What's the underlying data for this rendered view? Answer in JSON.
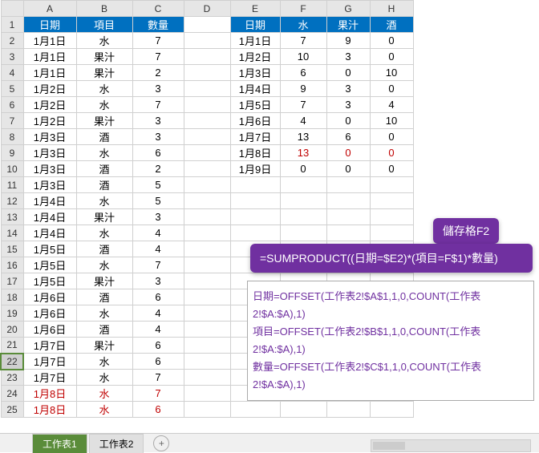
{
  "cols": [
    "A",
    "B",
    "C",
    "D",
    "E",
    "F",
    "G",
    "H"
  ],
  "left_headers": [
    "日期",
    "項目",
    "數量"
  ],
  "left_rows": [
    [
      "1月1日",
      "水",
      "7"
    ],
    [
      "1月1日",
      "果汁",
      "7"
    ],
    [
      "1月1日",
      "果汁",
      "2"
    ],
    [
      "1月2日",
      "水",
      "3"
    ],
    [
      "1月2日",
      "水",
      "7"
    ],
    [
      "1月2日",
      "果汁",
      "3"
    ],
    [
      "1月3日",
      "酒",
      "3"
    ],
    [
      "1月3日",
      "水",
      "6"
    ],
    [
      "1月3日",
      "酒",
      "2"
    ],
    [
      "1月3日",
      "酒",
      "5"
    ],
    [
      "1月4日",
      "水",
      "5"
    ],
    [
      "1月4日",
      "果汁",
      "3"
    ],
    [
      "1月4日",
      "水",
      "4"
    ],
    [
      "1月5日",
      "酒",
      "4"
    ],
    [
      "1月5日",
      "水",
      "7"
    ],
    [
      "1月5日",
      "果汁",
      "3"
    ],
    [
      "1月6日",
      "酒",
      "6"
    ],
    [
      "1月6日",
      "水",
      "4"
    ],
    [
      "1月6日",
      "酒",
      "4"
    ],
    [
      "1月7日",
      "果汁",
      "6"
    ],
    [
      "1月7日",
      "水",
      "6"
    ],
    [
      "1月7日",
      "水",
      "7"
    ],
    [
      "1月8日",
      "水",
      "7"
    ],
    [
      "1月8日",
      "水",
      "6"
    ]
  ],
  "left_red_start": 22,
  "right_headers": [
    "日期",
    "水",
    "果汁",
    "酒"
  ],
  "right_rows": [
    [
      "1月1日",
      "7",
      "9",
      "0"
    ],
    [
      "1月2日",
      "10",
      "3",
      "0"
    ],
    [
      "1月3日",
      "6",
      "0",
      "10"
    ],
    [
      "1月4日",
      "9",
      "3",
      "0"
    ],
    [
      "1月5日",
      "7",
      "3",
      "4"
    ],
    [
      "1月6日",
      "4",
      "0",
      "10"
    ],
    [
      "1月7日",
      "13",
      "6",
      "0"
    ],
    [
      "1月8日",
      "13",
      "0",
      "0"
    ],
    [
      "1月9日",
      "0",
      "0",
      "0"
    ]
  ],
  "right_red_row": 7,
  "formula_tag": "儲存格F2",
  "formula_text": "=SUMPRODUCT((日期=$E2)*(項目=F$1)*數量)",
  "defs": [
    "日期=OFFSET(工作表2!$A$1,1,0,COUNT(工作表2!$A:$A),1)",
    "項目=OFFSET(工作表2!$B$1,1,0,COUNT(工作表2!$A:$A),1)",
    "數量=OFFSET(工作表2!$C$1,1,0,COUNT(工作表2!$A:$A),1)"
  ],
  "tabs": {
    "active": "工作表1",
    "other": "工作表2"
  }
}
